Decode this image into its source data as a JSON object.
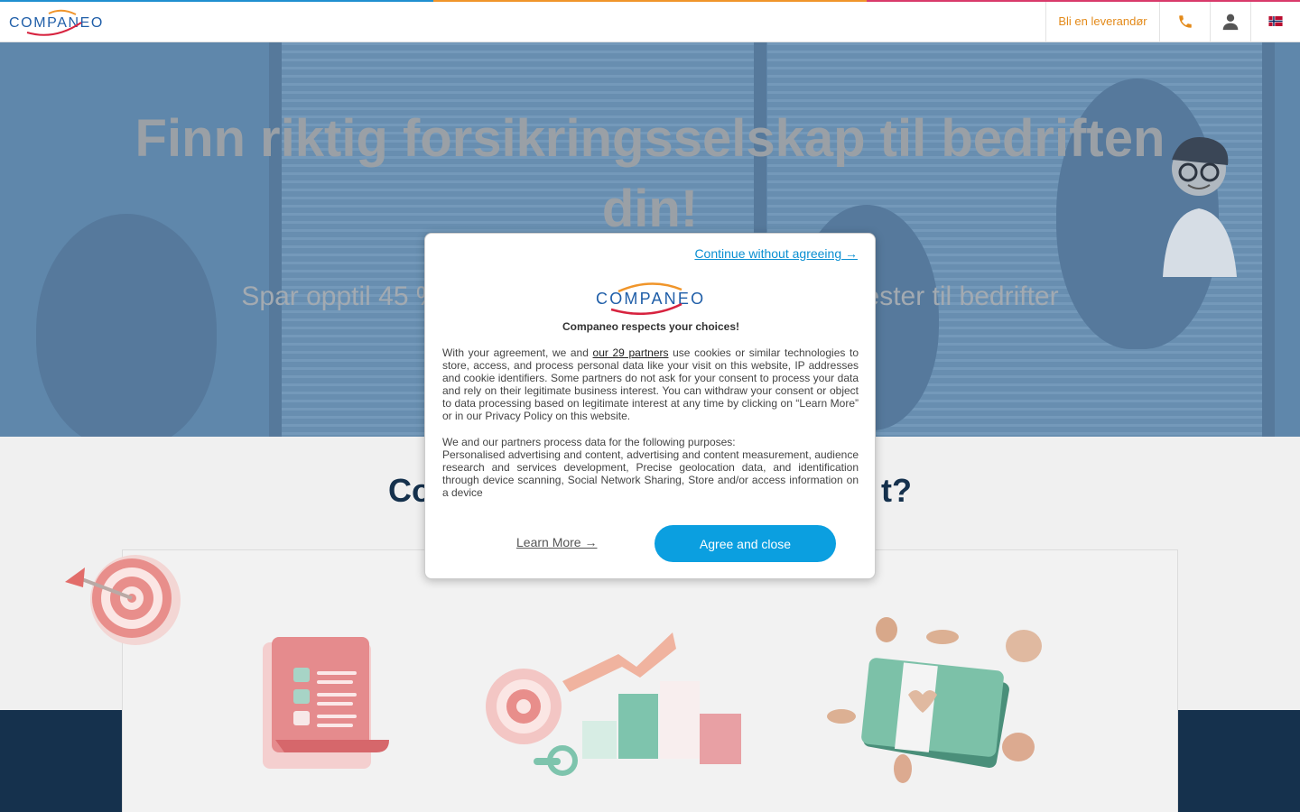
{
  "header": {
    "logo_text": "COMPANEO",
    "supplier_link": "Bli en leverandør",
    "icons": [
      "phone-icon",
      "user-icon",
      "norway-flag-icon"
    ],
    "stripe_colors": [
      "#1f8fd0",
      "#f0952a",
      "#d93a6b"
    ]
  },
  "hero": {
    "title": "Finn riktig forsikringsselskap til bedriften din!",
    "subtitle_left": "Spar opptil 45 %",
    "subtitle_right": "ester til bedrifter"
  },
  "section": {
    "title_left": "Co",
    "title_right": "t?"
  },
  "consent": {
    "continue_link": "Continue without agreeing →",
    "logo_text": "COMPANEO",
    "heading": "Companeo respects your choices!",
    "body_before": "With your agreement, we and ",
    "partners_link": "our 29 partners",
    "body_after": " use cookies or similar technologies to store, access, and process personal data like your visit on this website, IP addresses and cookie identifiers. Some partners do not ask for your consent to process your data and rely on their legitimate business interest. You can withdraw your consent or object to data processing based on legitimate interest at any time by clicking on “Learn More” or in our Privacy Policy on this website.",
    "purposes_intro": "We and our partners process data for the following purposes:",
    "purposes_list": "Personalised advertising and content, advertising and content measurement, audience research and services development, Precise geolocation data, and identification through device scanning, Social Network Sharing, Store and/or access information on a device",
    "learn_more": "Learn More →",
    "agree_button": "Agree and close"
  },
  "colors": {
    "accent_blue": "#0b9fe0",
    "supplier_orange": "#e38a1a",
    "navy": "#15314d"
  }
}
